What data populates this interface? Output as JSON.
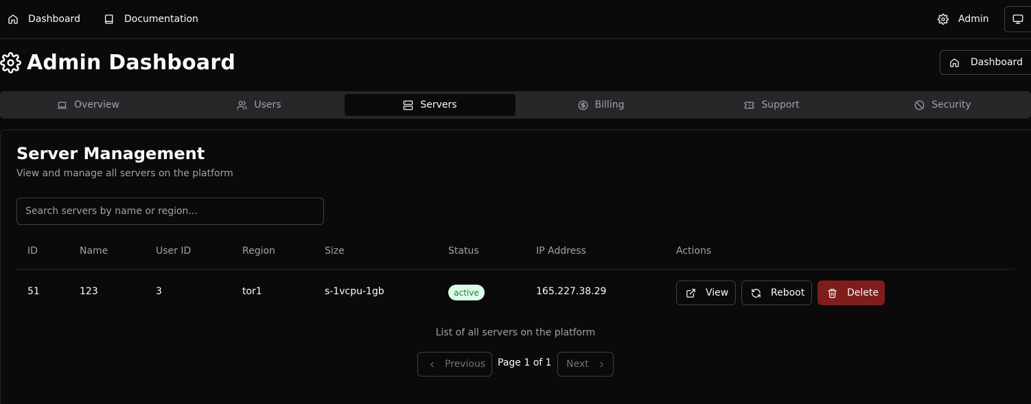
{
  "topnav": {
    "dashboard_label": "Dashboard",
    "documentation_label": "Documentation",
    "admin_label": "Admin"
  },
  "header": {
    "title": "Admin Dashboard",
    "dashboard_button_label": "Dashboard"
  },
  "tabs": [
    {
      "label": "Overview",
      "icon": "laptop-icon"
    },
    {
      "label": "Users",
      "icon": "users-icon"
    },
    {
      "label": "Servers",
      "icon": "server-icon",
      "active": true
    },
    {
      "label": "Billing",
      "icon": "dollar-circle-icon"
    },
    {
      "label": "Support",
      "icon": "ticket-icon"
    },
    {
      "label": "Security",
      "icon": "ban-icon"
    }
  ],
  "servers": {
    "title": "Server Management",
    "subtitle": "View and manage all servers on the platform",
    "search_placeholder": "Search servers by name or region...",
    "columns": [
      "ID",
      "Name",
      "User ID",
      "Region",
      "Size",
      "Status",
      "IP Address",
      "Actions"
    ],
    "rows": [
      {
        "id": "51",
        "name": "123",
        "user_id": "3",
        "region": "tor1",
        "size": "s-1vcpu-1gb",
        "status": "active",
        "ip": "165.227.38.29"
      }
    ],
    "actions": {
      "view": "View",
      "reboot": "Reboot",
      "delete": "Delete"
    },
    "caption": "List of all servers on the platform",
    "pagination": {
      "previous": "Previous",
      "page_text": "Page 1 of 1",
      "next": "Next"
    }
  },
  "colors": {
    "background": "#0a0a0b",
    "active_badge_bg": "#dcfce7",
    "active_badge_text": "#15803d",
    "delete_button": "#7f1d1d"
  }
}
